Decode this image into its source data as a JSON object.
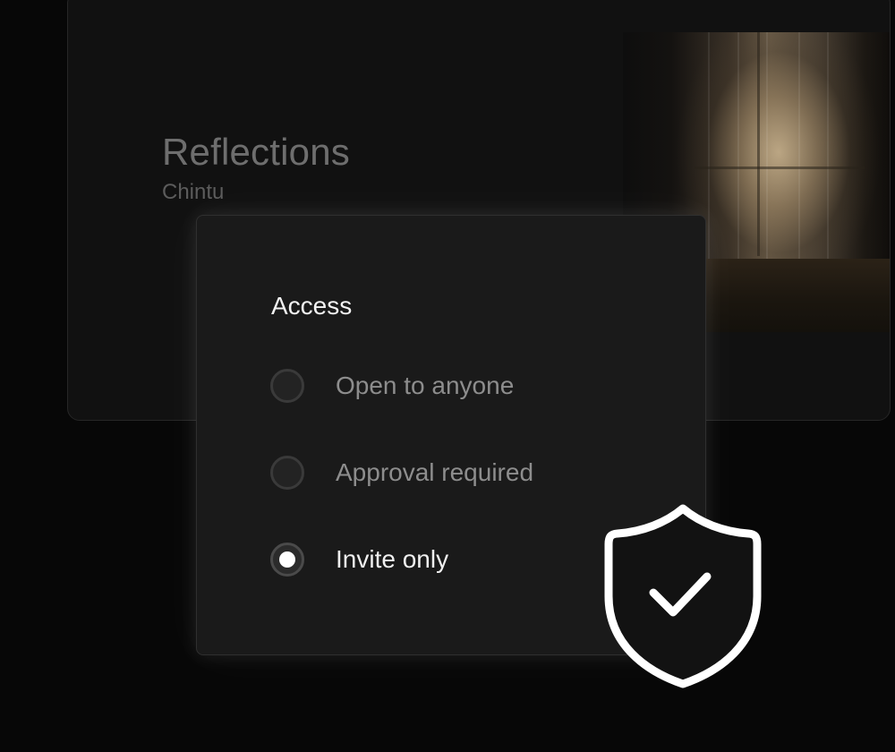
{
  "card": {
    "title": "Reflections",
    "author": "Chintu"
  },
  "access": {
    "title": "Access",
    "options": [
      {
        "label": "Open to anyone",
        "selected": false
      },
      {
        "label": "Approval required",
        "selected": false
      },
      {
        "label": "Invite only",
        "selected": true
      }
    ],
    "selected_value": "Invite only"
  },
  "icons": {
    "badge": "shield-check-icon"
  },
  "colors": {
    "background": "#070707",
    "panel": "#1a1a1a",
    "selected_dot": "#ffffff"
  }
}
